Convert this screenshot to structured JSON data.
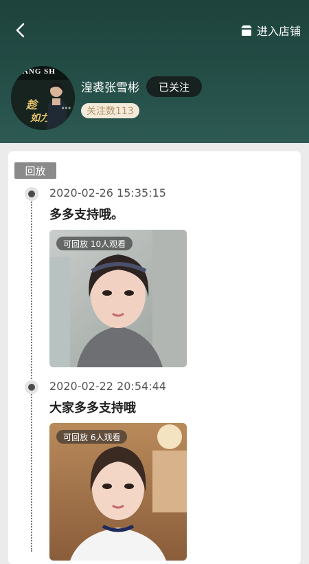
{
  "header": {
    "back_icon": "chevron-left-icon",
    "shop_icon": "store-icon",
    "shop_link_label": "进入店铺",
    "avatar_watermark": "UANG SH",
    "streamer_name": "湟裘张雪彬",
    "follow_label": "已关注",
    "follower_count_label": "关注数113"
  },
  "section": {
    "tag_label": "回放"
  },
  "posts": [
    {
      "timestamp": "2020-02-26 15:35:15",
      "title": "多多支持哦。",
      "badge": "可回放 10人观看"
    },
    {
      "timestamp": "2020-02-22 20:54:44",
      "title": "大家多多支持哦",
      "badge": "可回放 6人观看"
    }
  ],
  "colors": {
    "header_dark": "#1e423c",
    "follow_bg": "#17211f",
    "badge_bg": "#f4ead9",
    "badge_text": "#b0946c"
  }
}
